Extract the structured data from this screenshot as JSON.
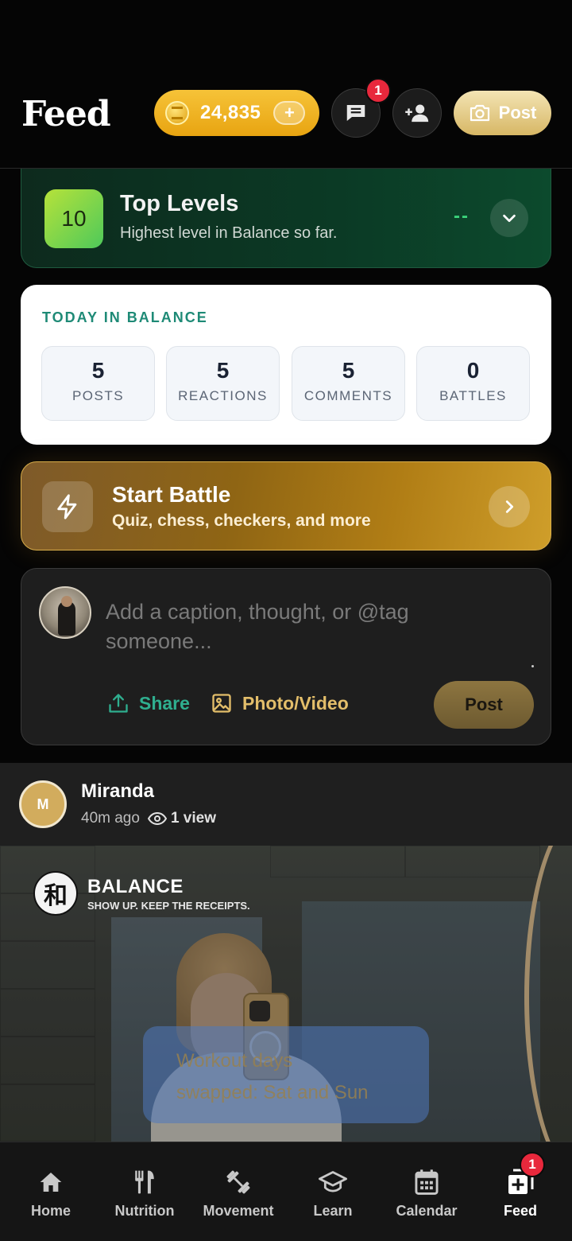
{
  "header": {
    "title": "Feed",
    "coins": "24,835",
    "coins_plus": "+",
    "messages_badge": "1",
    "post_label": "Post"
  },
  "levels": {
    "level": "10",
    "title": "Top Levels",
    "subtitle": "Highest level in Balance so far.",
    "value": "--"
  },
  "today": {
    "label": "TODAY IN BALANCE",
    "stats": [
      {
        "value": "5",
        "caption": "POSTS"
      },
      {
        "value": "5",
        "caption": "REACTIONS"
      },
      {
        "value": "5",
        "caption": "COMMENTS"
      },
      {
        "value": "0",
        "caption": "BATTLES"
      }
    ]
  },
  "battle": {
    "title": "Start Battle",
    "subtitle": "Quiz, chess, checkers, and more"
  },
  "composer": {
    "placeholder": "Add a caption, thought, or @tag someone...",
    "share_label": "Share",
    "photo_label": "Photo/Video",
    "post_label": "Post"
  },
  "post": {
    "author_initial": "M",
    "author": "Miranda",
    "time": "40m ago",
    "views": "1 view",
    "brand_name": "BALANCE",
    "brand_seal": "和",
    "brand_tagline": "SHOW UP. KEEP THE RECEIPTS.",
    "overlay_line1": "Workout days",
    "overlay_line2": "swapped: Sat and Sun"
  },
  "nav": {
    "items": [
      {
        "label": "Home",
        "icon": "home-icon"
      },
      {
        "label": "Nutrition",
        "icon": "utensils-icon"
      },
      {
        "label": "Movement",
        "icon": "dumbbell-icon"
      },
      {
        "label": "Learn",
        "icon": "graduation-cap-icon"
      },
      {
        "label": "Calendar",
        "icon": "calendar-icon"
      },
      {
        "label": "Feed",
        "icon": "feed-add-icon"
      }
    ],
    "feed_badge": "1",
    "active": "Feed"
  },
  "colors": {
    "accent_gold": "#e8a411",
    "accent_green": "#2fae8f",
    "badge_red": "#e8283c"
  }
}
